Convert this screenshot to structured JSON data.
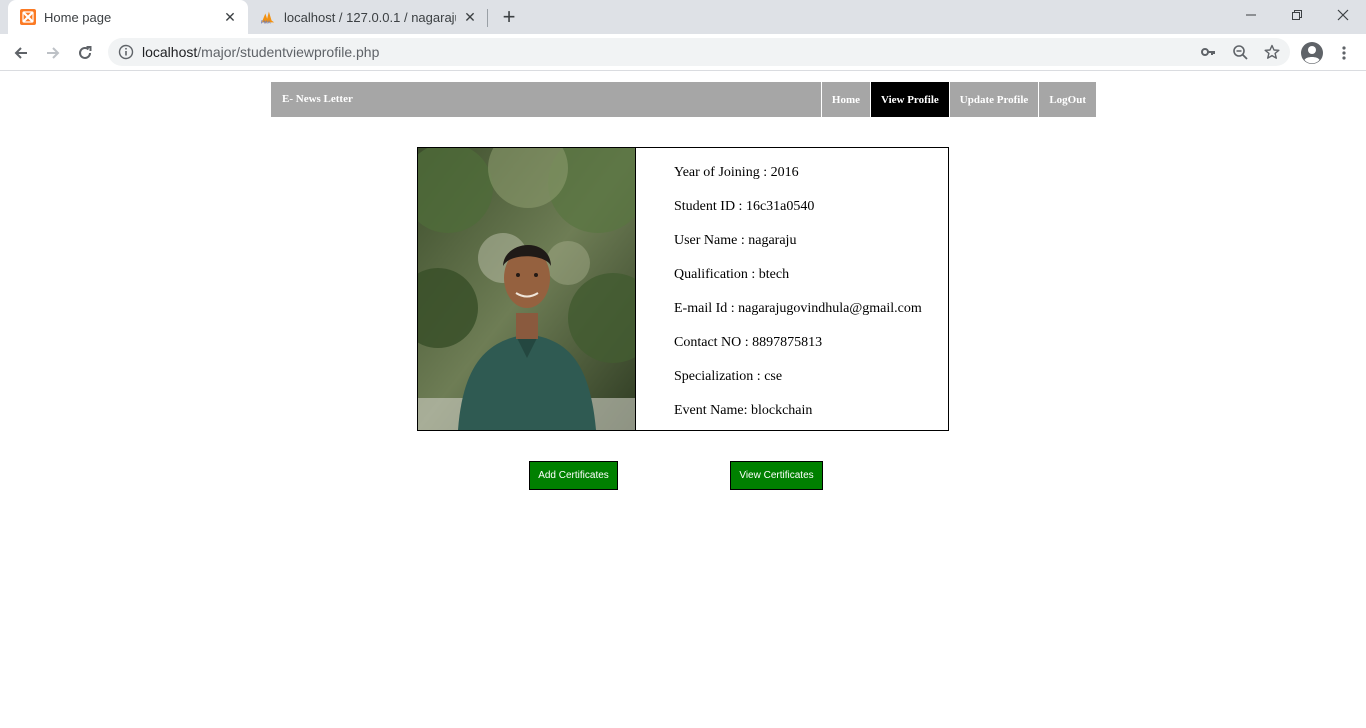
{
  "browser": {
    "tabs": [
      {
        "title": "Home page",
        "favicon": "xampp-icon",
        "active": true
      },
      {
        "title": "localhost / 127.0.0.1 / nagaraju / ",
        "favicon": "phpmyadmin-icon",
        "active": false
      }
    ],
    "url_host": "localhost",
    "url_path": "/major/studentviewprofile.php"
  },
  "nav": {
    "brand": "E- News Letter",
    "items": [
      {
        "label": "Home",
        "active": false
      },
      {
        "label": "View Profile",
        "active": true
      },
      {
        "label": "Update Profile",
        "active": false
      },
      {
        "label": "LogOut",
        "active": false
      }
    ]
  },
  "profile": {
    "fields": [
      "Year of Joining : 2016",
      "Student ID : 16c31a0540",
      "User Name : nagaraju",
      "Qualification : btech",
      "E-mail Id : nagarajugovindhula@gmail.com",
      "Contact NO : 8897875813",
      "Specialization : cse",
      "Event Name: blockchain"
    ]
  },
  "actions": {
    "add": "Add Certificates",
    "view": "View Certificates"
  },
  "colors": {
    "nav_bg": "#a6a6a6",
    "nav_active": "#000000",
    "button_green": "#008000"
  }
}
